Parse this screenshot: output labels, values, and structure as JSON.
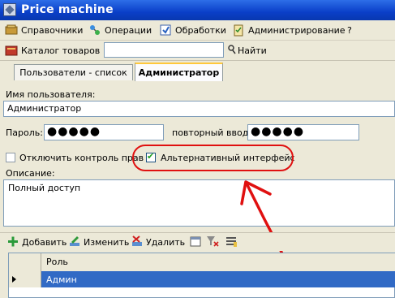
{
  "window": {
    "title": "Price machine",
    "app_icon": "app-diamond-icon"
  },
  "menu": [
    {
      "label": "Справочники",
      "icon": "books-icon"
    },
    {
      "label": "Операции",
      "icon": "operations-icon"
    },
    {
      "label": "Обработки",
      "icon": "processing-icon"
    },
    {
      "label": "Администрирование",
      "icon": "admin-clipboard-icon"
    },
    {
      "label": "?",
      "icon": ""
    }
  ],
  "toolbar": {
    "catalog_label": "Каталог товаров",
    "search_value": "",
    "find_label": "Найти"
  },
  "tabs": [
    {
      "label": "Пользователи - список",
      "active": false
    },
    {
      "label": "Администратор",
      "active": true
    }
  ],
  "form": {
    "username_label": "Имя пользователя:",
    "username_value": "Администратор",
    "password_label": "Пароль:",
    "password_value": "●●●●●",
    "repeat_label": "повторный ввод:",
    "repeat_value": "●●●●●",
    "disable_rights_label": "Отключить контроль прав",
    "disable_rights_checked": false,
    "alt_interface_label": "Альтернативный интерфейс",
    "alt_interface_checked": true,
    "description_label": "Описание:",
    "description_value": "Полный доступ"
  },
  "grid_toolbar": {
    "add_label": "Добавить",
    "edit_label": "Изменить",
    "delete_label": "Удалить"
  },
  "grid": {
    "columns": [
      "Роль"
    ],
    "rows": [
      {
        "role": "Админ",
        "selected": true
      }
    ]
  },
  "colors": {
    "title_bar": "#0a3fc8",
    "annotation": "#e01010",
    "selection": "#316ac5"
  }
}
